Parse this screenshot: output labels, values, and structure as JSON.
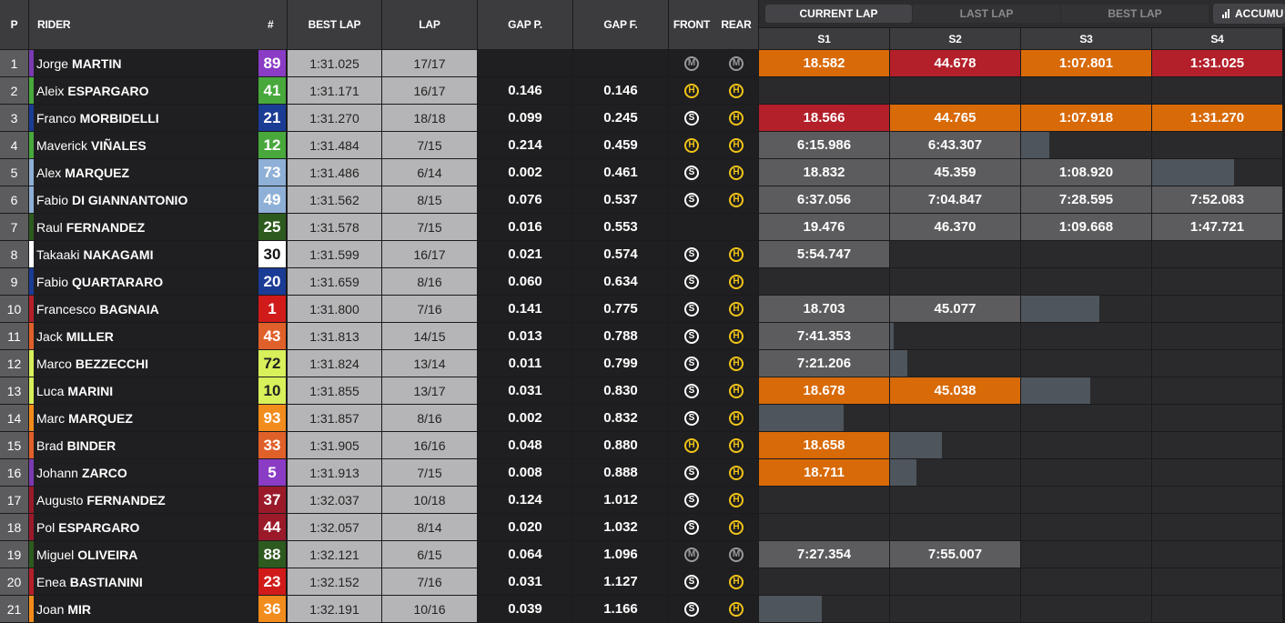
{
  "header": {
    "pos": "P",
    "rider": "RIDER",
    "num": "#",
    "best_lap": "BEST LAP",
    "lap": "LAP",
    "gap_p": "GAP P.",
    "gap_f": "GAP F.",
    "front": "FRONT",
    "rear": "REAR",
    "sectors": [
      "S1",
      "S2",
      "S3",
      "S4"
    ]
  },
  "tabs": {
    "current_lap": "CURRENT LAP",
    "last_lap": "LAST LAP",
    "best_lap": "BEST LAP",
    "accum": "ACCUMU",
    "accum_icon": "bar-chart-icon"
  },
  "colors": {
    "orange": "#d86a08",
    "red": "#b3202a",
    "grey": "#5c5c5e",
    "dim": "#4e555c"
  },
  "rows": [
    {
      "pos": "1",
      "first": "Jorge",
      "last": "MARTIN",
      "num": "89",
      "num_bg": "#8a3cc4",
      "num_fg": "#fff",
      "stripe": "#7a3ab0",
      "best": "1:31.025",
      "lap": "17/17",
      "gap_p": "",
      "gap_f": "",
      "front": "M",
      "rear": "M",
      "s": [
        {
          "t": "18.582",
          "c": "orange"
        },
        {
          "t": "44.678",
          "c": "red"
        },
        {
          "t": "1:07.801",
          "c": "orange"
        },
        {
          "t": "1:31.025",
          "c": "red"
        }
      ]
    },
    {
      "pos": "2",
      "first": "Aleix",
      "last": "ESPARGARO",
      "num": "41",
      "num_bg": "#48a83c",
      "num_fg": "#fff",
      "stripe": "#48a83c",
      "best": "1:31.171",
      "lap": "16/17",
      "gap_p": "0.146",
      "gap_f": "0.146",
      "front": "H",
      "rear": "H",
      "s": [
        {},
        {},
        {},
        {}
      ]
    },
    {
      "pos": "3",
      "first": "Franco",
      "last": "MORBIDELLI",
      "num": "21",
      "num_bg": "#1b3c94",
      "num_fg": "#fff",
      "stripe": "#1b3c94",
      "best": "1:31.270",
      "lap": "18/18",
      "gap_p": "0.099",
      "gap_f": "0.245",
      "front": "S",
      "rear": "H",
      "s": [
        {
          "t": "18.566",
          "c": "red"
        },
        {
          "t": "44.765",
          "c": "orange"
        },
        {
          "t": "1:07.918",
          "c": "orange"
        },
        {
          "t": "1:31.270",
          "c": "orange"
        }
      ]
    },
    {
      "pos": "4",
      "first": "Maverick",
      "last": "VIÑALES",
      "num": "12",
      "num_bg": "#48a83c",
      "num_fg": "#fff",
      "stripe": "#48a83c",
      "best": "1:31.484",
      "lap": "7/15",
      "gap_p": "0.214",
      "gap_f": "0.459",
      "front": "H",
      "rear": "H",
      "s": [
        {
          "t": "6:15.986",
          "c": "grey"
        },
        {
          "t": "6:43.307",
          "c": "grey"
        },
        {
          "p": 0.22
        },
        {}
      ]
    },
    {
      "pos": "5",
      "first": "Alex",
      "last": "MARQUEZ",
      "num": "73",
      "num_bg": "#8fb0d6",
      "num_fg": "#fff",
      "stripe": "#8fb0d6",
      "best": "1:31.486",
      "lap": "6/14",
      "gap_p": "0.002",
      "gap_f": "0.461",
      "front": "S",
      "rear": "H",
      "s": [
        {
          "t": "18.832",
          "c": "grey"
        },
        {
          "t": "45.359",
          "c": "grey"
        },
        {
          "t": "1:08.920",
          "c": "grey"
        },
        {
          "p": 0.63
        }
      ]
    },
    {
      "pos": "6",
      "first": "Fabio",
      "last": "DI GIANNANTONIO",
      "num": "49",
      "num_bg": "#8fb0d6",
      "num_fg": "#fff",
      "stripe": "#8fb0d6",
      "best": "1:31.562",
      "lap": "8/15",
      "gap_p": "0.076",
      "gap_f": "0.537",
      "front": "S",
      "rear": "H",
      "s": [
        {
          "t": "6:37.056",
          "c": "grey"
        },
        {
          "t": "7:04.847",
          "c": "grey"
        },
        {
          "t": "7:28.595",
          "c": "grey"
        },
        {
          "t": "7:52.083",
          "c": "grey"
        }
      ]
    },
    {
      "pos": "7",
      "first": "Raul",
      "last": "FERNANDEZ",
      "num": "25",
      "num_bg": "#2d5a1e",
      "num_fg": "#fff",
      "stripe": "#2d5a1e",
      "best": "1:31.578",
      "lap": "7/15",
      "gap_p": "0.016",
      "gap_f": "0.553",
      "front": "",
      "rear": "",
      "s": [
        {
          "t": "19.476",
          "c": "grey"
        },
        {
          "t": "46.370",
          "c": "grey"
        },
        {
          "t": "1:09.668",
          "c": "grey"
        },
        {
          "t": "1:47.721",
          "c": "grey"
        }
      ]
    },
    {
      "pos": "8",
      "first": "Takaaki",
      "last": "NAKAGAMI",
      "num": "30",
      "num_bg": "#ffffff",
      "num_fg": "#111",
      "stripe": "#ffffff",
      "best": "1:31.599",
      "lap": "16/17",
      "gap_p": "0.021",
      "gap_f": "0.574",
      "front": "S",
      "rear": "H",
      "s": [
        {
          "t": "5:54.747",
          "c": "grey"
        },
        {},
        {},
        {}
      ]
    },
    {
      "pos": "9",
      "first": "Fabio",
      "last": "QUARTARARO",
      "num": "20",
      "num_bg": "#1b3c94",
      "num_fg": "#fff",
      "stripe": "#1b3c94",
      "best": "1:31.659",
      "lap": "8/16",
      "gap_p": "0.060",
      "gap_f": "0.634",
      "front": "S",
      "rear": "H",
      "s": [
        {},
        {},
        {},
        {}
      ]
    },
    {
      "pos": "10",
      "first": "Francesco",
      "last": "BAGNAIA",
      "num": "1",
      "num_bg": "#d11a1a",
      "num_fg": "#fff",
      "stripe": "#b3202a",
      "best": "1:31.800",
      "lap": "7/16",
      "gap_p": "0.141",
      "gap_f": "0.775",
      "front": "S",
      "rear": "H",
      "s": [
        {
          "t": "18.703",
          "c": "grey"
        },
        {
          "t": "45.077",
          "c": "grey"
        },
        {
          "p": 0.6
        },
        {}
      ]
    },
    {
      "pos": "11",
      "first": "Jack",
      "last": "MILLER",
      "num": "43",
      "num_bg": "#e0602a",
      "num_fg": "#fff",
      "stripe": "#e0602a",
      "best": "1:31.813",
      "lap": "14/15",
      "gap_p": "0.013",
      "gap_f": "0.788",
      "front": "S",
      "rear": "H",
      "s": [
        {
          "t": "7:41.353",
          "c": "grey"
        },
        {
          "p": 0.03
        },
        {},
        {}
      ]
    },
    {
      "pos": "12",
      "first": "Marco",
      "last": "BEZZECCHI",
      "num": "72",
      "num_bg": "#d8f05a",
      "num_fg": "#222",
      "stripe": "#d8f05a",
      "best": "1:31.824",
      "lap": "13/14",
      "gap_p": "0.011",
      "gap_f": "0.799",
      "front": "S",
      "rear": "H",
      "s": [
        {
          "t": "7:21.206",
          "c": "grey"
        },
        {
          "p": 0.13
        },
        {},
        {}
      ]
    },
    {
      "pos": "13",
      "first": "Luca",
      "last": "MARINI",
      "num": "10",
      "num_bg": "#d8f05a",
      "num_fg": "#222",
      "stripe": "#d8f05a",
      "best": "1:31.855",
      "lap": "13/17",
      "gap_p": "0.031",
      "gap_f": "0.830",
      "front": "S",
      "rear": "H",
      "s": [
        {
          "t": "18.678",
          "c": "orange"
        },
        {
          "t": "45.038",
          "c": "orange"
        },
        {
          "p": 0.53
        },
        {}
      ]
    },
    {
      "pos": "14",
      "first": "Marc",
      "last": "MARQUEZ",
      "num": "93",
      "num_bg": "#f28c1c",
      "num_fg": "#fff",
      "stripe": "#f28c1c",
      "best": "1:31.857",
      "lap": "8/16",
      "gap_p": "0.002",
      "gap_f": "0.832",
      "front": "S",
      "rear": "H",
      "s": [
        {
          "p": 0.65
        },
        {},
        {},
        {}
      ]
    },
    {
      "pos": "15",
      "first": "Brad",
      "last": "BINDER",
      "num": "33",
      "num_bg": "#e0602a",
      "num_fg": "#fff",
      "stripe": "#e0602a",
      "best": "1:31.905",
      "lap": "16/16",
      "gap_p": "0.048",
      "gap_f": "0.880",
      "front": "H",
      "rear": "H",
      "s": [
        {
          "t": "18.658",
          "c": "orange"
        },
        {
          "p": 0.4
        },
        {},
        {}
      ]
    },
    {
      "pos": "16",
      "first": "Johann",
      "last": "ZARCO",
      "num": "5",
      "num_bg": "#8a3cc4",
      "num_fg": "#fff",
      "stripe": "#7a3ab0",
      "best": "1:31.913",
      "lap": "7/15",
      "gap_p": "0.008",
      "gap_f": "0.888",
      "front": "S",
      "rear": "H",
      "s": [
        {
          "t": "18.711",
          "c": "orange"
        },
        {
          "p": 0.2
        },
        {},
        {}
      ]
    },
    {
      "pos": "17",
      "first": "Augusto",
      "last": "FERNANDEZ",
      "num": "37",
      "num_bg": "#9a1a2a",
      "num_fg": "#fff",
      "stripe": "#9a1a2a",
      "best": "1:32.037",
      "lap": "10/18",
      "gap_p": "0.124",
      "gap_f": "1.012",
      "front": "S",
      "rear": "H",
      "s": [
        {},
        {},
        {},
        {}
      ]
    },
    {
      "pos": "18",
      "first": "Pol",
      "last": "ESPARGARO",
      "num": "44",
      "num_bg": "#9a1a2a",
      "num_fg": "#fff",
      "stripe": "#9a1a2a",
      "best": "1:32.057",
      "lap": "8/14",
      "gap_p": "0.020",
      "gap_f": "1.032",
      "front": "S",
      "rear": "H",
      "s": [
        {},
        {},
        {},
        {}
      ]
    },
    {
      "pos": "19",
      "first": "Miguel",
      "last": "OLIVEIRA",
      "num": "88",
      "num_bg": "#2d5a1e",
      "num_fg": "#fff",
      "stripe": "#2d5a1e",
      "best": "1:32.121",
      "lap": "6/15",
      "gap_p": "0.064",
      "gap_f": "1.096",
      "front": "M",
      "rear": "M",
      "s": [
        {
          "t": "7:27.354",
          "c": "grey"
        },
        {
          "t": "7:55.007",
          "c": "grey"
        },
        {},
        {}
      ]
    },
    {
      "pos": "20",
      "first": "Enea",
      "last": "BASTIANINI",
      "num": "23",
      "num_bg": "#d11a1a",
      "num_fg": "#fff",
      "stripe": "#b3202a",
      "best": "1:32.152",
      "lap": "7/16",
      "gap_p": "0.031",
      "gap_f": "1.127",
      "front": "S",
      "rear": "H",
      "s": [
        {},
        {},
        {},
        {}
      ]
    },
    {
      "pos": "21",
      "first": "Joan",
      "last": "MIR",
      "num": "36",
      "num_bg": "#f28c1c",
      "num_fg": "#fff",
      "stripe": "#f28c1c",
      "best": "1:32.191",
      "lap": "10/16",
      "gap_p": "0.039",
      "gap_f": "1.166",
      "front": "S",
      "rear": "H",
      "s": [
        {
          "p": 0.48
        },
        {},
        {},
        {}
      ]
    }
  ]
}
